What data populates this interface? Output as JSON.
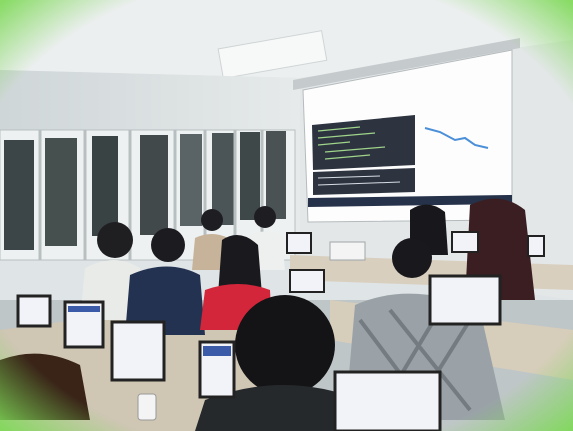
{
  "scene": {
    "frame_color": "#7ed957",
    "wall_color": "#dde2e4",
    "ceiling_color": "#e9ecec",
    "screen_bg": "#fdfdfd",
    "editor_bg": "#2d3440",
    "taskbar_color": "#26324a",
    "plot_color": "#4a8fd8",
    "laptop_screen_color": "#f1f3f8"
  }
}
